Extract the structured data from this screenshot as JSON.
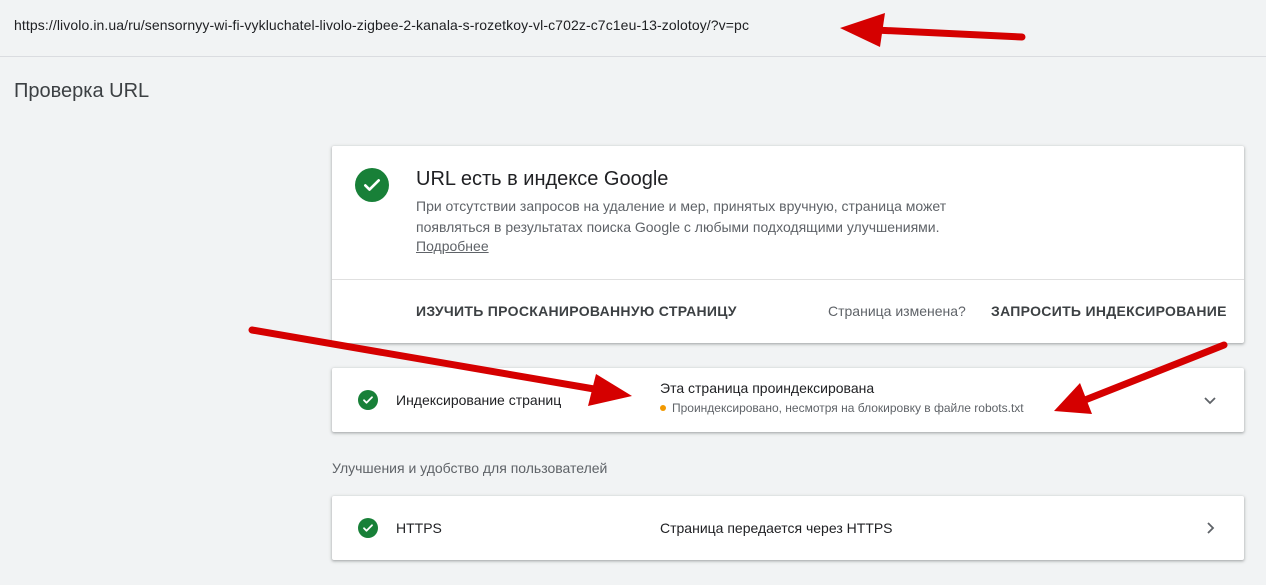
{
  "url_bar": {
    "url": "https://livolo.in.ua/ru/sensornyy-wi-fi-vykluchatel-livolo-zigbee-2-kanala-s-rozetkoy-vl-c702z-c7c1eu-13-zolotoy/?v=pc"
  },
  "page": {
    "title": "Проверка URL"
  },
  "status_card": {
    "title": "URL есть в индексе Google",
    "description": "При отсутствии запросов на удаление и мер, принятых вручную, страница может появляться в результатах поиска Google с любыми подходящими улучшениями.",
    "learn_more": "Подробнее",
    "inspect_button": "ИЗУЧИТЬ ПРОСКАНИРОВАННУЮ СТРАНИЦУ",
    "changed_question": "Страница изменена?",
    "request_button": "ЗАПРОСИТЬ ИНДЕКСИРОВАНИЕ"
  },
  "indexing_row": {
    "label": "Индексирование страниц",
    "value": "Эта страница проиндексирована",
    "sub": "Проиндексировано, несмотря на блокировку в файле robots.txt"
  },
  "enhancements": {
    "section_label": "Улучшения и удобство для пользователей",
    "https_row": {
      "label": "HTTPS",
      "value": "Страница передается через HTTPS"
    }
  },
  "colors": {
    "success": "#188038",
    "warning": "#f29900",
    "annotation_arrow": "#d50000"
  },
  "icons": [
    "check-circle-icon",
    "chevron-down-icon",
    "chevron-right-icon",
    "red-arrow-annotation"
  ]
}
